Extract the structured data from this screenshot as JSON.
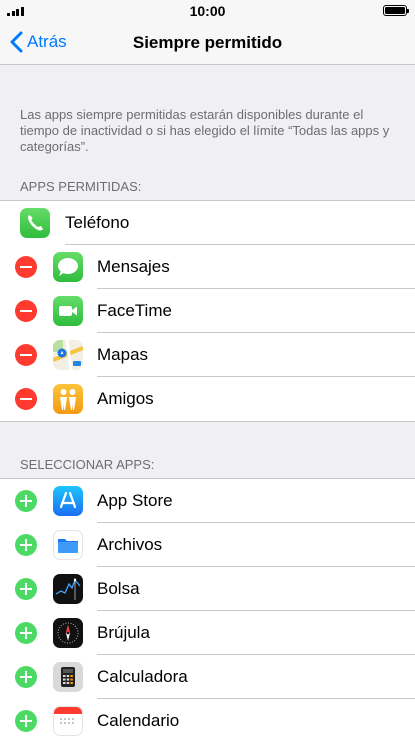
{
  "status_bar": {
    "time": "10:00"
  },
  "nav": {
    "back_label": "Atrás",
    "title": "Siempre permitido"
  },
  "description": "Las apps siempre permitidas estarán disponibles durante el tiempo de inactividad o si has elegido el límite “Todas las apps y categorías”.",
  "allowed": {
    "header": "APPS PERMITIDAS:",
    "items": [
      {
        "label": "Teléfono",
        "icon": "phone-icon"
      },
      {
        "label": "Mensajes",
        "icon": "messages-icon"
      },
      {
        "label": "FaceTime",
        "icon": "facetime-icon"
      },
      {
        "label": "Mapas",
        "icon": "maps-icon"
      },
      {
        "label": "Amigos",
        "icon": "find-friends-icon"
      }
    ]
  },
  "select": {
    "header": "SELECCIONAR APPS:",
    "items": [
      {
        "label": "App Store",
        "icon": "app-store-icon"
      },
      {
        "label": "Archivos",
        "icon": "files-icon"
      },
      {
        "label": "Bolsa",
        "icon": "stocks-icon"
      },
      {
        "label": "Brújula",
        "icon": "compass-icon"
      },
      {
        "label": "Calculadora",
        "icon": "calculator-icon"
      },
      {
        "label": "Calendario",
        "icon": "calendar-icon"
      }
    ]
  },
  "colors": {
    "accent": "#007aff",
    "remove": "#ff3b30",
    "add": "#4cd964"
  }
}
